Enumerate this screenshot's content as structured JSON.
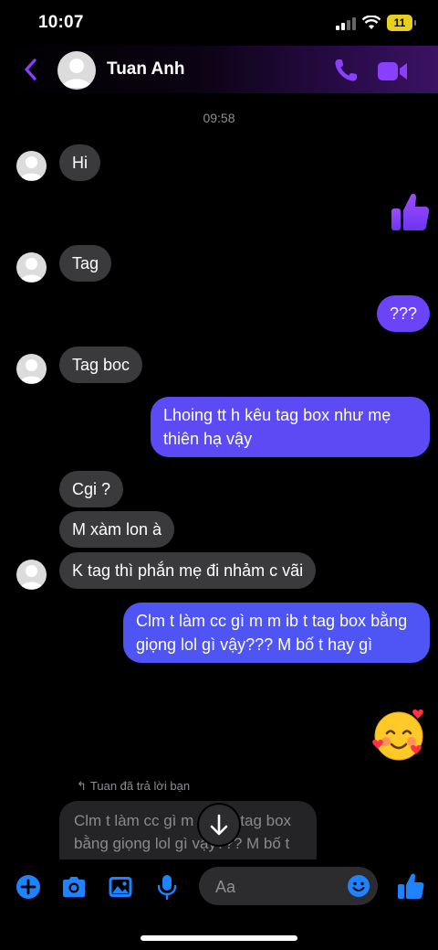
{
  "status": {
    "time": "10:07",
    "battery": "11"
  },
  "header": {
    "contact_name": "Tuan Anh"
  },
  "chat": {
    "timestamp": "09:58",
    "messages": [
      {
        "dir": "in",
        "text": "Hi"
      },
      {
        "dir": "out",
        "type": "like"
      },
      {
        "dir": "in",
        "text": "Tag"
      },
      {
        "dir": "out",
        "text": "???"
      },
      {
        "dir": "in",
        "text": "Tag boc"
      },
      {
        "dir": "out",
        "text": "Lhoing tt h kêu tag box như mẹ thiên hạ vậy"
      },
      {
        "dir": "in",
        "text": "Cgi ?"
      },
      {
        "dir": "in",
        "text": "M xàm lon à"
      },
      {
        "dir": "in",
        "text": "K tag thì phắn mẹ đi nhảm c vãi"
      },
      {
        "dir": "out",
        "text": "Clm t làm cc gì m m ib t tag box bằng giọng lol gì vậy??? M bố t hay gì"
      },
      {
        "dir": "out",
        "type": "emoji",
        "emoji": "smiling-face-with-hearts"
      }
    ],
    "reply_note": "Tuan đã trả lời bạn",
    "reply_quote": "Clm t làm cc gì m m ib t tag box bằng giọng lol gì vậy??? M bố t hay gì"
  },
  "composer": {
    "placeholder": "Aa"
  },
  "colors": {
    "accent": "#8a3ffc",
    "outgoing_bubble": "#5a4df6",
    "incoming_bubble": "#3a3a3c",
    "icon_blue": "#1f82ff"
  }
}
